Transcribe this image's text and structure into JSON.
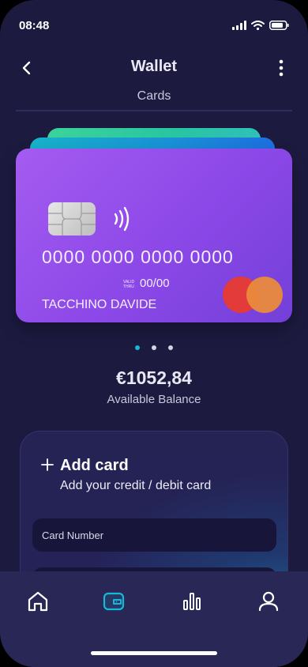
{
  "status_bar": {
    "time": "08:48"
  },
  "header": {
    "title": "Wallet",
    "subtitle": "Cards"
  },
  "card": {
    "number": "0000 0000 0000 0000",
    "valid_label_line1": "VALID",
    "valid_label_line2": "THRU",
    "expiry": "00/00",
    "holder": "TACCHINO DAVIDE",
    "brand_icon": "mastercard-logo"
  },
  "pagination": {
    "count": 3,
    "active_index": 0
  },
  "balance": {
    "amount": "€1052,84",
    "label": "Available Balance"
  },
  "add_card": {
    "title": "Add card",
    "subtitle": "Add your credit / debit card",
    "card_number_placeholder": "Card Number"
  },
  "nav": {
    "items": [
      {
        "icon": "home-icon",
        "active": false
      },
      {
        "icon": "wallet-icon",
        "active": true
      },
      {
        "icon": "stats-icon",
        "active": false
      },
      {
        "icon": "profile-icon",
        "active": false
      }
    ]
  },
  "colors": {
    "background": "#1c1a3f",
    "card_gradient_start": "#a45bf0",
    "card_gradient_end": "#7340d8",
    "accent": "#17b7d7",
    "nav_background": "#282756"
  }
}
